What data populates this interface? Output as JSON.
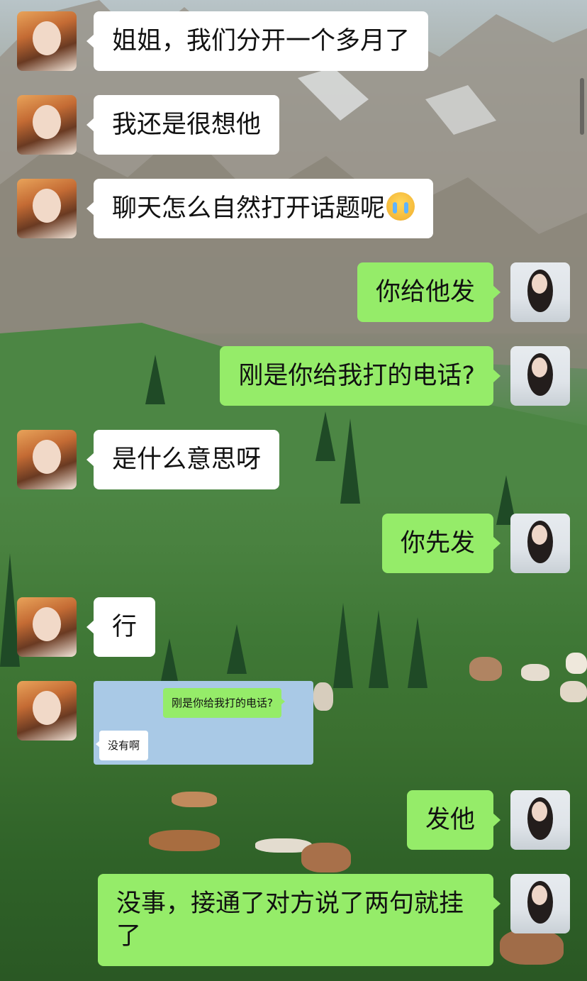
{
  "colors": {
    "incoming_bubble": "#ffffff",
    "outgoing_bubble": "#95ec69",
    "forwarded_image_bg": "#a9c9e6"
  },
  "messages": [
    {
      "side": "in",
      "text": "姐姐，我们分开一个多月了"
    },
    {
      "side": "in",
      "text": "我还是很想他"
    },
    {
      "side": "in",
      "text": "聊天怎么自然打开话题呢",
      "emoji": "crying-face-icon"
    },
    {
      "side": "out",
      "text": "你给他发"
    },
    {
      "side": "out",
      "text": "刚是你给我打的电话?"
    },
    {
      "side": "in",
      "text": "是什么意思呀"
    },
    {
      "side": "out",
      "text": "你先发"
    },
    {
      "side": "in",
      "text": "行"
    },
    {
      "side": "in",
      "type": "image",
      "image": {
        "out_text": "刚是你给我打的电话?",
        "in_text": "没有啊"
      }
    },
    {
      "side": "out",
      "text": "发他"
    },
    {
      "side": "out",
      "text": "没事，接通了对方说了两句就挂了"
    }
  ]
}
